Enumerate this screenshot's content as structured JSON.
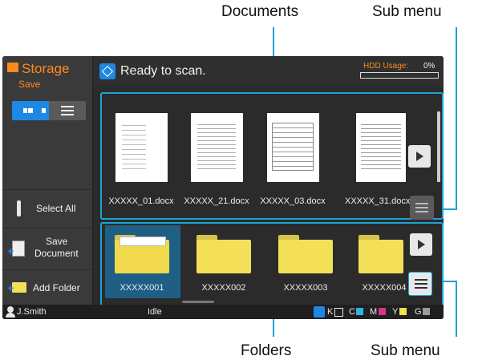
{
  "callouts": {
    "documents": "Documents",
    "sub_menu_top": "Sub menu",
    "folders": "Folders",
    "sub_menu_bottom": "Sub menu"
  },
  "sidebar": {
    "title": "Storage",
    "subtitle": "Save",
    "select_all": "Select All",
    "save_document_line1": "Save",
    "save_document_line2": "Document",
    "add_folder": "Add Folder"
  },
  "header": {
    "status": "Ready to scan.",
    "hdd_label": "HDD Usage:",
    "hdd_value": "0%",
    "hdd_fraction": 0
  },
  "documents": [
    {
      "name": "XXXXX_01.docx"
    },
    {
      "name": "XXXXX_21.docx"
    },
    {
      "name": "XXXXX_03.docx"
    },
    {
      "name": "XXXXX_31.docx"
    }
  ],
  "folders": [
    {
      "name": "XXXXX001"
    },
    {
      "name": "XXXXX002"
    },
    {
      "name": "XXXXX003"
    },
    {
      "name": "XXXXX004"
    }
  ],
  "statusbar": {
    "user": "J.Smith",
    "state": "Idle",
    "inks": [
      "K",
      "C",
      "M",
      "Y",
      "G"
    ]
  },
  "colors": {
    "accent_orange": "#ff8a1c",
    "accent_blue": "#1e88e5",
    "callout_cyan": "#1aa3d6",
    "folder_yellow": "#f3df58",
    "selected_tile": "#1f5f86"
  }
}
